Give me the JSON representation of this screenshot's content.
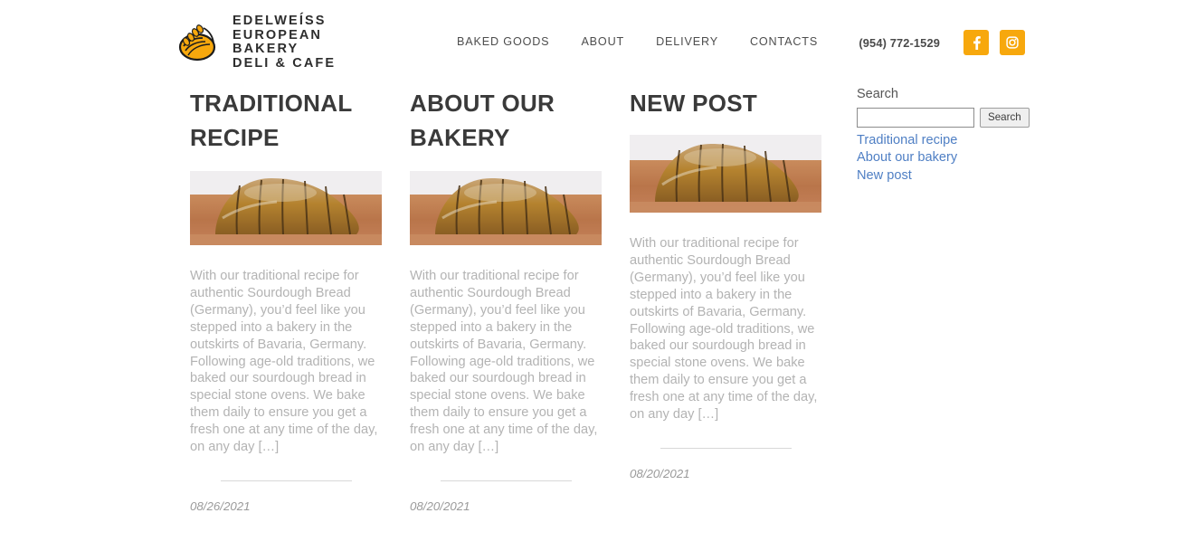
{
  "header": {
    "logo": {
      "icon": "bread-loaf-wheat-logo-icon",
      "lines": [
        "EDELWEÍSS",
        "EUROPEAN",
        "BAKERY",
        "DELI & CAFE"
      ],
      "text_block": "EDELWEÍSS\nEUROPEAN\nBAKERY\nDELI & CAFE",
      "mark_color": "#f7a80d",
      "text_color": "#2d2d2d"
    },
    "nav": [
      {
        "label": "BAKED GOODS"
      },
      {
        "label": "ABOUT"
      },
      {
        "label": "DELIVERY"
      },
      {
        "label": "CONTACTS"
      }
    ],
    "phone": "(954) 772-1529",
    "social": [
      {
        "name": "facebook",
        "glyph": "f",
        "bg": "#f7a80d"
      },
      {
        "name": "instagram",
        "glyph": "camera",
        "bg": "#f7a80d"
      }
    ]
  },
  "posts": [
    {
      "title": "TRADITIONAL RECIPE",
      "image_alt": "sliced sourdough bread loaf on wooden board",
      "excerpt": "With our traditional recipe for authentic Sourdough Bread (Germany), you’d feel like you stepped into a bakery in the outskirts of Bavaria, Germany. Following age-old traditions, we baked our sourdough bread in special stone ovens. We bake them daily to ensure you get a fresh one at any time of the day, on any day […]",
      "date": "08/26/2021"
    },
    {
      "title": "ABOUT OUR BAKERY",
      "image_alt": "sliced sourdough bread loaf on wooden board",
      "excerpt": "With our traditional recipe for authentic Sourdough Bread (Germany), you’d feel like you stepped into a bakery in the outskirts of Bavaria, Germany. Following age-old traditions, we baked our sourdough bread in special stone ovens. We bake them daily to ensure you get a fresh one at any time of the day, on any day […]",
      "date": "08/20/2021"
    },
    {
      "title": "NEW POST",
      "image_alt": "sliced sourdough bread loaf on wooden board",
      "excerpt": "With our traditional recipe for authentic Sourdough Bread (Germany), you’d feel like you stepped into a bakery in the outskirts of Bavaria, Germany. Following age-old traditions, we baked our sourdough bread in special stone ovens. We bake them daily to ensure you get a fresh one at any time of the day, on any day […]",
      "date": "08/20/2021"
    }
  ],
  "sidebar": {
    "search": {
      "label": "Search",
      "value": "",
      "placeholder": "",
      "button_label": "Search"
    },
    "links": [
      {
        "label": "Traditional recipe"
      },
      {
        "label": "About our bakery"
      },
      {
        "label": "New post"
      }
    ],
    "link_color": "#4f7fc4"
  }
}
